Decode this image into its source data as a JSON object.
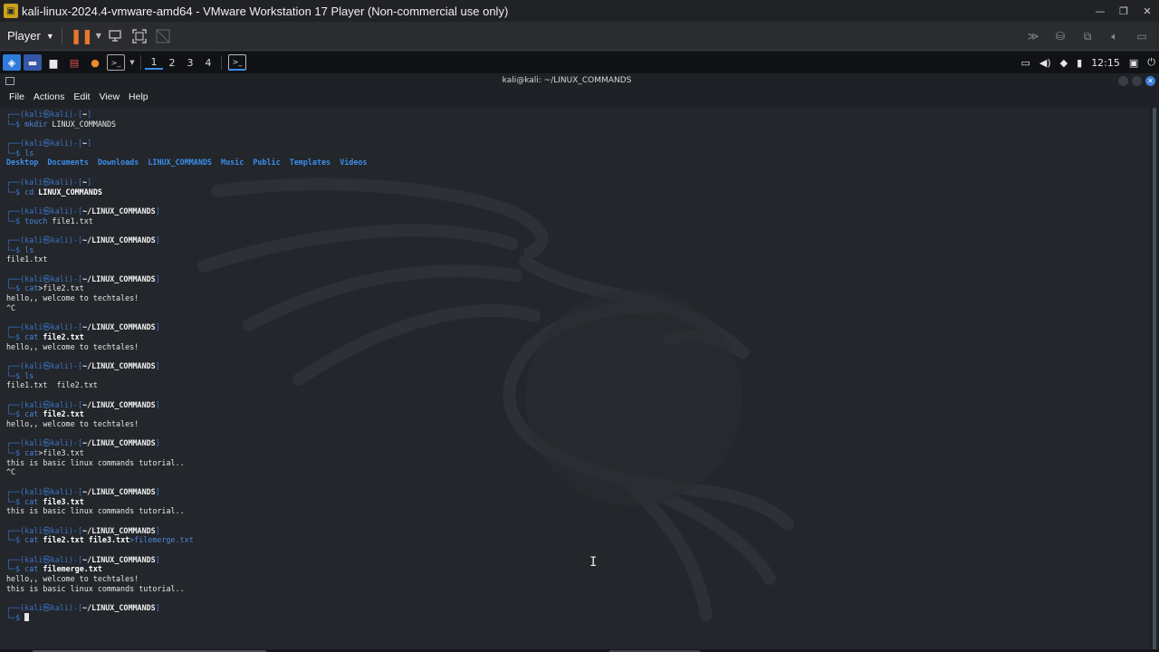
{
  "vm": {
    "title": "kali-linux-2024.4-vmware-amd64 - VMware Workstation 17 Player (Non-commercial use only)",
    "player_menu": "Player",
    "win_minimize": "—",
    "win_restore": "❐",
    "win_close": "✕"
  },
  "panel": {
    "workspaces": [
      "1",
      "2",
      "3",
      "4"
    ],
    "clock": "12:15"
  },
  "terminal": {
    "title": "kali@kali: ~/LINUX_COMMANDS",
    "menu": [
      "File",
      "Actions",
      "Edit",
      "View",
      "Help"
    ],
    "prompt": {
      "user_host": "kali㉿kali",
      "home": "~"
    },
    "blocks": [
      {
        "path": "~",
        "cmd": "mkdir",
        "args": " LINUX_COMMANDS",
        "bold": false,
        "output": []
      },
      {
        "path": "~",
        "cmd": "ls",
        "args": "",
        "bold": false,
        "dirs": [
          "Desktop",
          "Documents",
          "Downloads",
          "LINUX_COMMANDS",
          "Music",
          "Public",
          "Templates",
          "Videos"
        ],
        "output": []
      },
      {
        "path": "~",
        "cmd": "cd",
        "args": " LINUX_COMMANDS",
        "bold": true,
        "output": []
      },
      {
        "path": "~/LINUX_COMMANDS",
        "cmd": "touch",
        "args": " file1.txt",
        "bold": false,
        "output": []
      },
      {
        "path": "~/LINUX_COMMANDS",
        "cmd": "ls",
        "args": "",
        "bold": false,
        "output": [
          "file1.txt"
        ]
      },
      {
        "path": "~/LINUX_COMMANDS",
        "cmd": "cat",
        "args": ">file2.txt",
        "bold": false,
        "output": [
          "hello,, welcome to techtales!",
          "^C"
        ]
      },
      {
        "path": "~/LINUX_COMMANDS",
        "cmd": "cat",
        "args": " file2.txt",
        "bold": true,
        "output": [
          "hello,, welcome to techtales!"
        ]
      },
      {
        "path": "~/LINUX_COMMANDS",
        "cmd": "ls",
        "args": "",
        "bold": false,
        "output": [
          "file1.txt  file2.txt"
        ]
      },
      {
        "path": "~/LINUX_COMMANDS",
        "cmd": "cat",
        "args": " file2.txt",
        "bold": true,
        "output": [
          "hello,, welcome to techtales!"
        ]
      },
      {
        "path": "~/LINUX_COMMANDS",
        "cmd": "cat",
        "args": ">file3.txt",
        "bold": false,
        "output": [
          "this is basic linux commands tutorial..",
          "^C"
        ]
      },
      {
        "path": "~/LINUX_COMMANDS",
        "cmd": "cat",
        "args": " file3.txt",
        "bold": true,
        "output": [
          "this is basic linux commands tutorial.."
        ]
      },
      {
        "path": "~/LINUX_COMMANDS",
        "cmd": "cat",
        "args": " file2.txt file3.txt",
        "args2": ">filemerge.txt",
        "bold": true,
        "output": []
      },
      {
        "path": "~/LINUX_COMMANDS",
        "cmd": "cat",
        "args": " filemerge.txt",
        "bold": true,
        "output": [
          "hello,, welcome to techtales!",
          "this is basic linux commands tutorial.."
        ]
      },
      {
        "path": "~/LINUX_COMMANDS",
        "cmd": "",
        "args": "",
        "bold": false,
        "cursor": true,
        "output": []
      }
    ]
  },
  "icons": {
    "vmware_logo": "vmware-logo-icon",
    "pause": "pause-icon",
    "send_ctrl_alt_del": "send-keys-icon",
    "fullscreen": "fullscreen-icon",
    "unity": "unity-icon",
    "kali_menu": "kali-menu-icon",
    "clock_lock": "lock-icon"
  },
  "colors": {
    "prompt_blue": "#3b73c5",
    "dir_blue": "#3b8eea",
    "pause_orange": "#e8762c",
    "terminal_bg": "#23262b"
  }
}
